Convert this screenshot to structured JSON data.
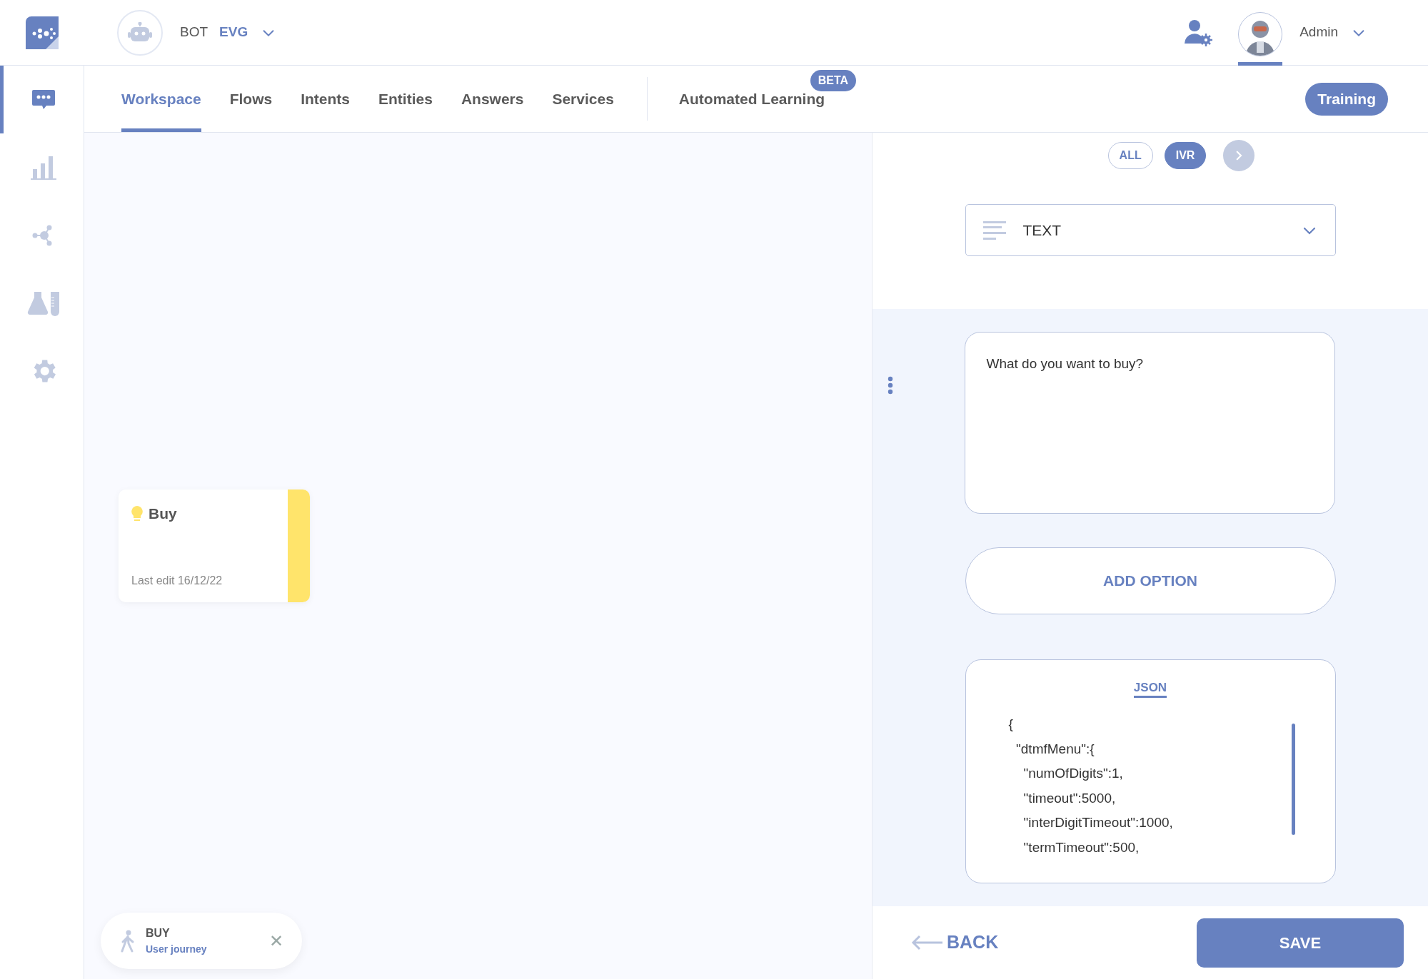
{
  "header": {
    "bot_label": "BOT",
    "bot_name": "EVG",
    "user_name": "Admin"
  },
  "sidebar": {
    "items": [
      {
        "kind": "chat",
        "selected": true
      },
      {
        "kind": "stats",
        "selected": false
      },
      {
        "kind": "network",
        "selected": false
      },
      {
        "kind": "lab",
        "selected": false
      },
      {
        "kind": "settings",
        "selected": false
      }
    ]
  },
  "tabs": [
    {
      "label": "Workspace",
      "selected": true
    },
    {
      "label": "Flows",
      "selected": false
    },
    {
      "label": "Intents",
      "selected": false
    },
    {
      "label": "Entities",
      "selected": false
    },
    {
      "label": "Answers",
      "selected": false
    },
    {
      "label": "Services",
      "selected": false
    }
  ],
  "extra_tab": {
    "label": "Automated Learning",
    "badge": "BETA",
    "selected": false
  },
  "training_button": "Training",
  "canvas": {
    "card": {
      "title": "Buy",
      "meta": "Last edit 16/12/22",
      "color": "#ffe46b"
    },
    "chip": {
      "title": "BUY",
      "subtitle": "User journey",
      "close": "✕"
    }
  },
  "panel": {
    "filters": [
      {
        "label": "ALL",
        "selected": false
      },
      {
        "label": "IVR",
        "selected": true
      }
    ],
    "type_select": {
      "value": "TEXT"
    },
    "message": {
      "value": "What do you want to buy?"
    },
    "add_option": "ADD OPTION",
    "json_tab": "JSON",
    "json_lines": [
      "{",
      "  \"dtmfMenu\":{",
      "    \"numOfDigits\":1,",
      "    \"timeout\":5000,",
      "    \"interDigitTimeout\":1000,",
      "    \"termTimeout\":500,"
    ],
    "back": "BACK",
    "save": "SAVE"
  }
}
